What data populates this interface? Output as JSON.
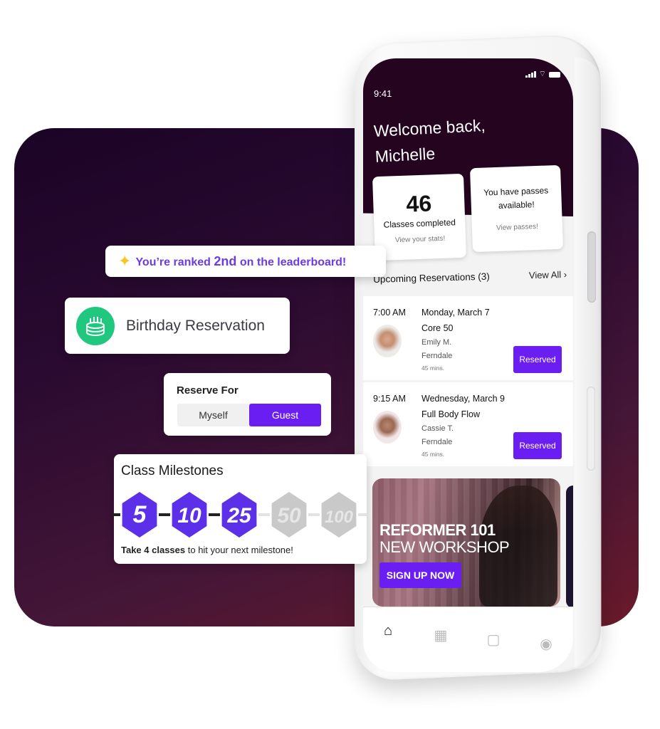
{
  "colors": {
    "accent": "#6b1ef2",
    "header_bg": "#250420",
    "milestone_done": "#5b30e8",
    "milestone_todo": "#c9c9c9",
    "birthday_green": "#1fc77f",
    "sparkle_yellow": "#f6c81e",
    "rank_text": "#6a3ce8"
  },
  "phone": {
    "status_bar": {
      "time": "9:41",
      "icons": [
        "signal-icon",
        "wifi-icon",
        "battery-icon"
      ]
    },
    "welcome": {
      "line1": "Welcome back,",
      "line2": "Michelle"
    },
    "stats": {
      "classes_completed": {
        "value": "46",
        "label": "Classes completed",
        "link": "View your stats!"
      },
      "passes": {
        "text_line1": "You have passes",
        "text_line2": "available!",
        "link": "View passes!"
      }
    },
    "upcoming": {
      "title": "Upcoming Reservations (3)",
      "view_all": "View All ›",
      "reservations": [
        {
          "time": "7:00 AM",
          "date": "Monday, March 7",
          "class": "Core 50",
          "instructor": "Emily M.",
          "location": "Ferndale",
          "duration": "45 mins.",
          "button": "Reserved"
        },
        {
          "time": "9:15 AM",
          "date": "Wednesday, March 9",
          "class": "Full Body Flow",
          "instructor": "Cassie T.",
          "location": "Ferndale",
          "duration": "45 mins.",
          "button": "Reserved"
        }
      ]
    },
    "banner": {
      "title": "REFORMER 101",
      "subtitle": "NEW WORKSHOP",
      "cta": "SIGN UP NOW"
    },
    "tabbar": [
      {
        "icon": "home-icon",
        "glyph": "⌂",
        "active": true
      },
      {
        "icon": "calendar-icon",
        "glyph": "▦",
        "active": false
      },
      {
        "icon": "shopping-bag-icon",
        "glyph": "▢",
        "active": false
      },
      {
        "icon": "profile-icon",
        "glyph": "◉",
        "active": false
      }
    ]
  },
  "overlays": {
    "leaderboard": {
      "icon": "sparkles-icon",
      "glyph": "✨",
      "prefix": "You’re ranked ",
      "rank": "2nd",
      "suffix": " on the leaderboard!"
    },
    "birthday": {
      "icon": "cake-icon",
      "label": "Birthday Reservation"
    },
    "reserve_for": {
      "title": "Reserve For",
      "options": [
        "Myself",
        "Guest"
      ],
      "selected": "Guest"
    },
    "milestones": {
      "title": "Class Milestones",
      "items": [
        {
          "value": "5",
          "achieved": true
        },
        {
          "value": "10",
          "achieved": true
        },
        {
          "value": "25",
          "achieved": true
        },
        {
          "value": "50",
          "achieved": false
        },
        {
          "value": "100",
          "achieved": false
        }
      ],
      "note_bold": "Take 4 classes",
      "note_rest": " to hit your next milestone!"
    }
  }
}
